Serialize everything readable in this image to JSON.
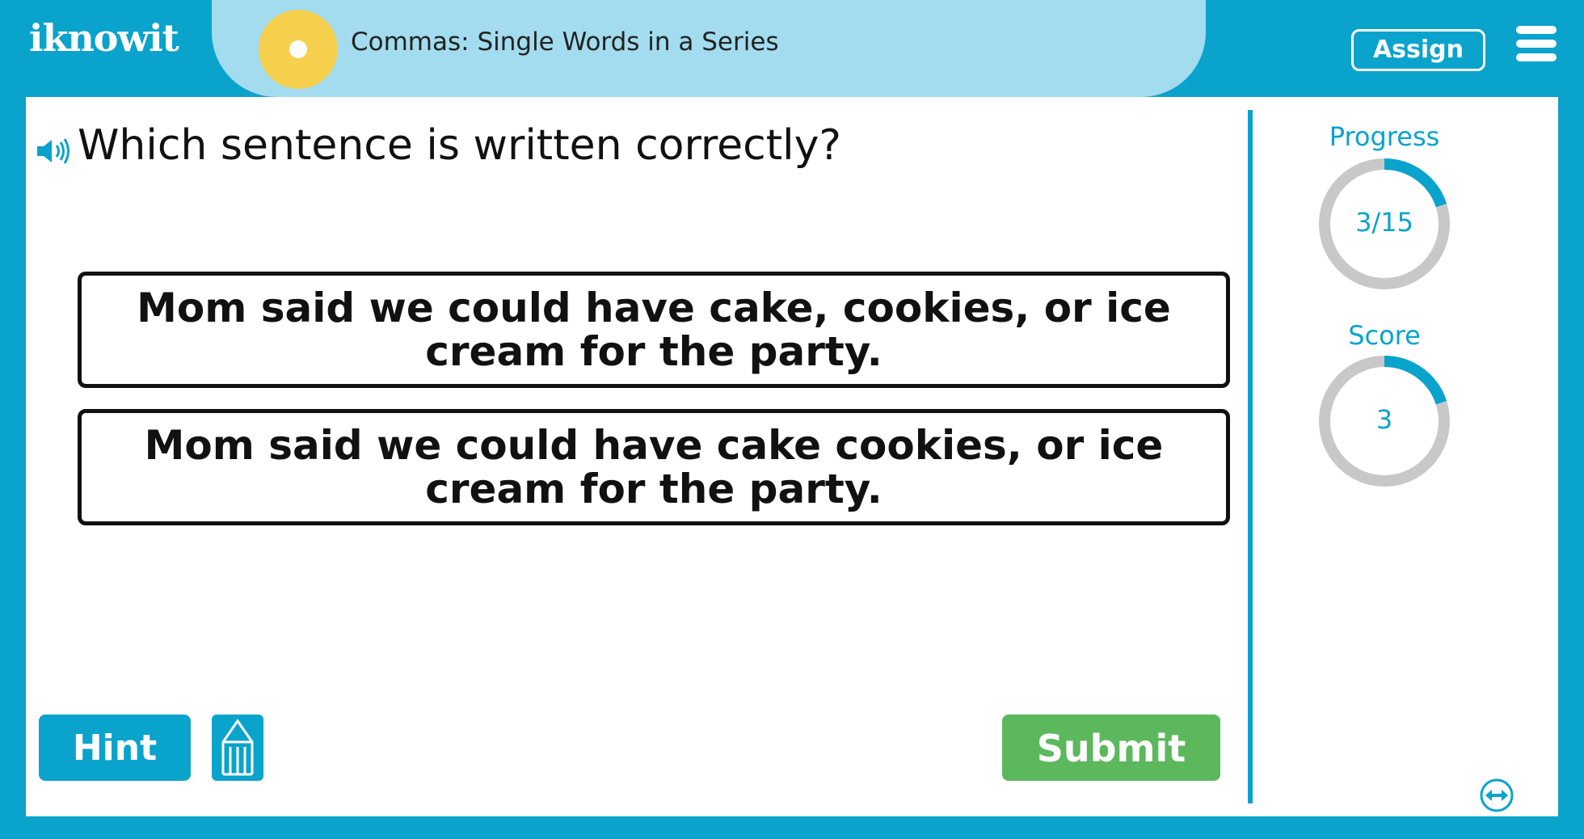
{
  "header": {
    "logo_text": "iknowit",
    "lesson_title": "Commas: Single Words in a Series",
    "assign_label": "Assign",
    "menu_icon": "hamburger-menu-icon"
  },
  "question": {
    "text": "Which sentence is written correctly?",
    "audio_icon": "speaker-icon"
  },
  "options": [
    {
      "text": "Mom said we could have cake, cookies, or ice cream for the party."
    },
    {
      "text": "Mom said we could have cake cookies, or ice cream for the party."
    }
  ],
  "buttons": {
    "hint_label": "Hint",
    "submit_label": "Submit",
    "pencil_icon": "pencil-icon"
  },
  "panel": {
    "progress_label": "Progress",
    "progress_value": "3/15",
    "progress_fraction": 0.2,
    "score_label": "Score",
    "score_value": "3",
    "score_fraction": 0.2
  },
  "colors": {
    "accent": "#0aa3cc",
    "pill": "#a2dcee",
    "circle": "#f6d04d",
    "submit": "#5cb85c",
    "ring_track": "#c8c8c8"
  }
}
